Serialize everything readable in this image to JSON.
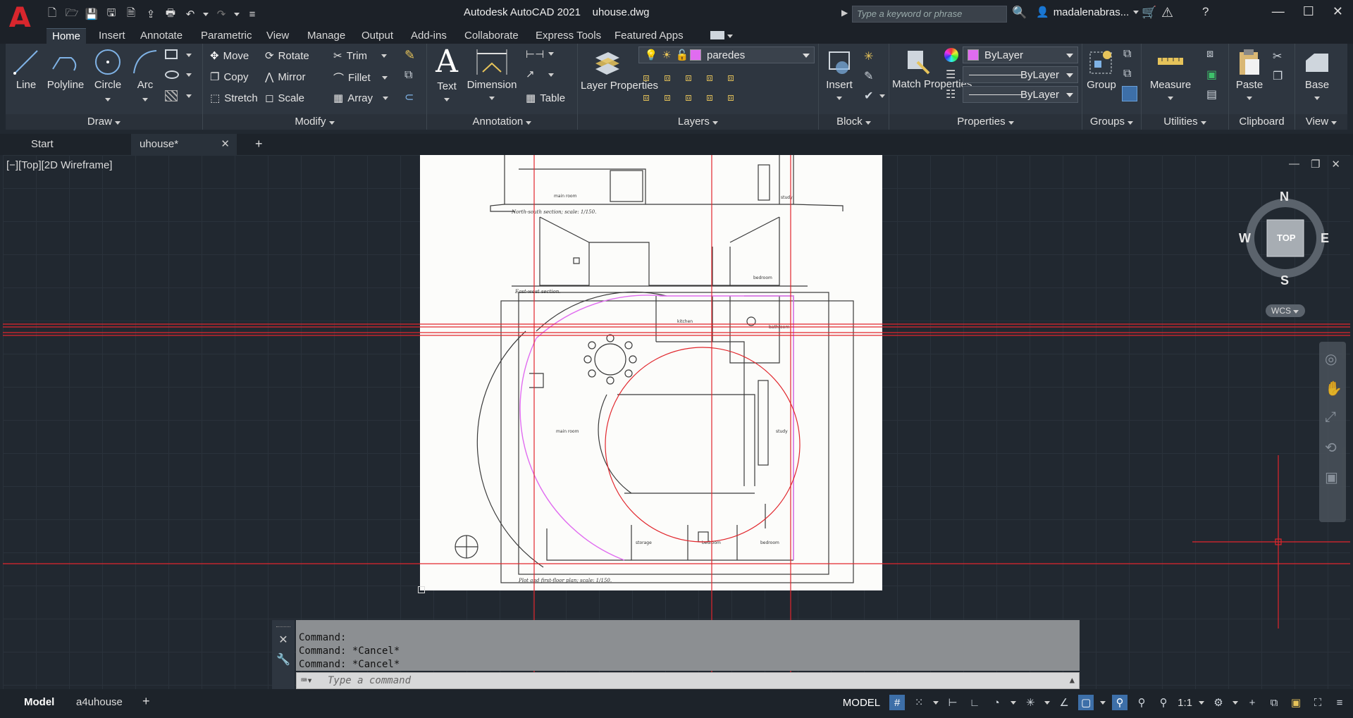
{
  "app": {
    "title": "Autodesk AutoCAD 2021",
    "filename": "uhouse.dwg",
    "logo": "A"
  },
  "search": {
    "placeholder": "Type a keyword or phrase"
  },
  "user": {
    "name": "madalenabras..."
  },
  "ribbon_tabs": [
    "Home",
    "Insert",
    "Annotate",
    "Parametric",
    "View",
    "Manage",
    "Output",
    "Add-ins",
    "Collaborate",
    "Express Tools",
    "Featured Apps"
  ],
  "draw": {
    "title": "Draw",
    "line": "Line",
    "polyline": "Polyline",
    "circle": "Circle",
    "arc": "Arc"
  },
  "modify": {
    "title": "Modify",
    "move": "Move",
    "rotate": "Rotate",
    "trim": "Trim",
    "copy": "Copy",
    "mirror": "Mirror",
    "fillet": "Fillet",
    "stretch": "Stretch",
    "scale": "Scale",
    "array": "Array"
  },
  "annotation": {
    "title": "Annotation",
    "text": "Text",
    "dimension": "Dimension",
    "table": "Table"
  },
  "layers": {
    "title": "Layers",
    "layer_properties": "Layer Properties",
    "current_layer": "paredes",
    "layer_color": "#e06cf0"
  },
  "block": {
    "title": "Block",
    "insert": "Insert"
  },
  "properties": {
    "title": "Properties",
    "match": "Match Properties",
    "color": "ByLayer",
    "linetype": "ByLayer",
    "lineweight": "ByLayer"
  },
  "groups": {
    "title": "Groups",
    "group": "Group"
  },
  "utilities": {
    "title": "Utilities",
    "measure": "Measure"
  },
  "clipboard": {
    "title": "Clipboard",
    "paste": "Paste"
  },
  "view_panel": {
    "title": "View",
    "base": "Base"
  },
  "doc_tabs": {
    "start": "Start",
    "current": "uhouse*",
    "add": "+"
  },
  "viewport": {
    "label": "[−][Top][2D Wireframe]"
  },
  "viewcube": {
    "n": "N",
    "s": "S",
    "e": "E",
    "w": "W",
    "face": "TOP",
    "wcs": "WCS"
  },
  "drawing_labels": {
    "ns_section": "North-south section; scale: 1/150.",
    "ew_section": "East-west section.",
    "plan": "Plot and first-floor plan; scale: 1/150.",
    "main_room_top": "main room",
    "study_top": "study",
    "bedroom_top": "bedroom",
    "kitchen": "kitchen",
    "bathroom": "bathroom",
    "main_room": "main room",
    "study": "study",
    "storage": "storage",
    "bedroom1": "bedroom",
    "bedroom2": "bedroom"
  },
  "command": {
    "history": [
      "Command:",
      "Command: *Cancel*",
      "Command: *Cancel*"
    ],
    "placeholder": "Type a command"
  },
  "layout_tabs": {
    "model": "Model",
    "layout1": "a4uhouse",
    "add": "+"
  },
  "status": {
    "model": "MODEL",
    "scale": "1:1"
  },
  "colors": {
    "accent_red": "#e1262c",
    "ribbon_bg": "#2e3640",
    "layer_magenta": "#e06cf0"
  }
}
